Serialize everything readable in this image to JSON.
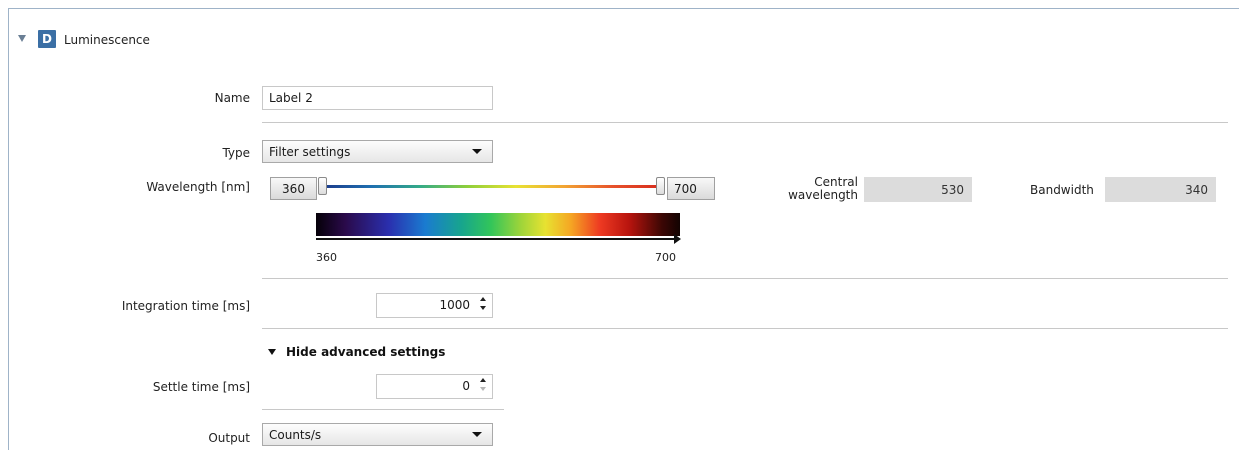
{
  "section": {
    "badge": "D",
    "title": "Luminescence"
  },
  "name_field": {
    "label": "Name",
    "value": "Label 2"
  },
  "type_field": {
    "label": "Type",
    "selected": "Filter settings"
  },
  "wavelength": {
    "label": "Wavelength [nm]",
    "min_value": "360",
    "max_value": "700",
    "range_start": 360,
    "range_end": 700,
    "spectrum_start_label": "360",
    "spectrum_end_label": "700"
  },
  "central_wavelength": {
    "label_line1": "Central",
    "label_line2": "wavelength",
    "value": "530"
  },
  "bandwidth": {
    "label": "Bandwidth",
    "value": "340"
  },
  "integration_time": {
    "label": "Integration time [ms]",
    "value": "1000"
  },
  "advanced_toggle": {
    "label": "Hide advanced settings"
  },
  "settle_time": {
    "label": "Settle time [ms]",
    "value": "0"
  },
  "output": {
    "label": "Output",
    "selected": "Counts/s"
  }
}
